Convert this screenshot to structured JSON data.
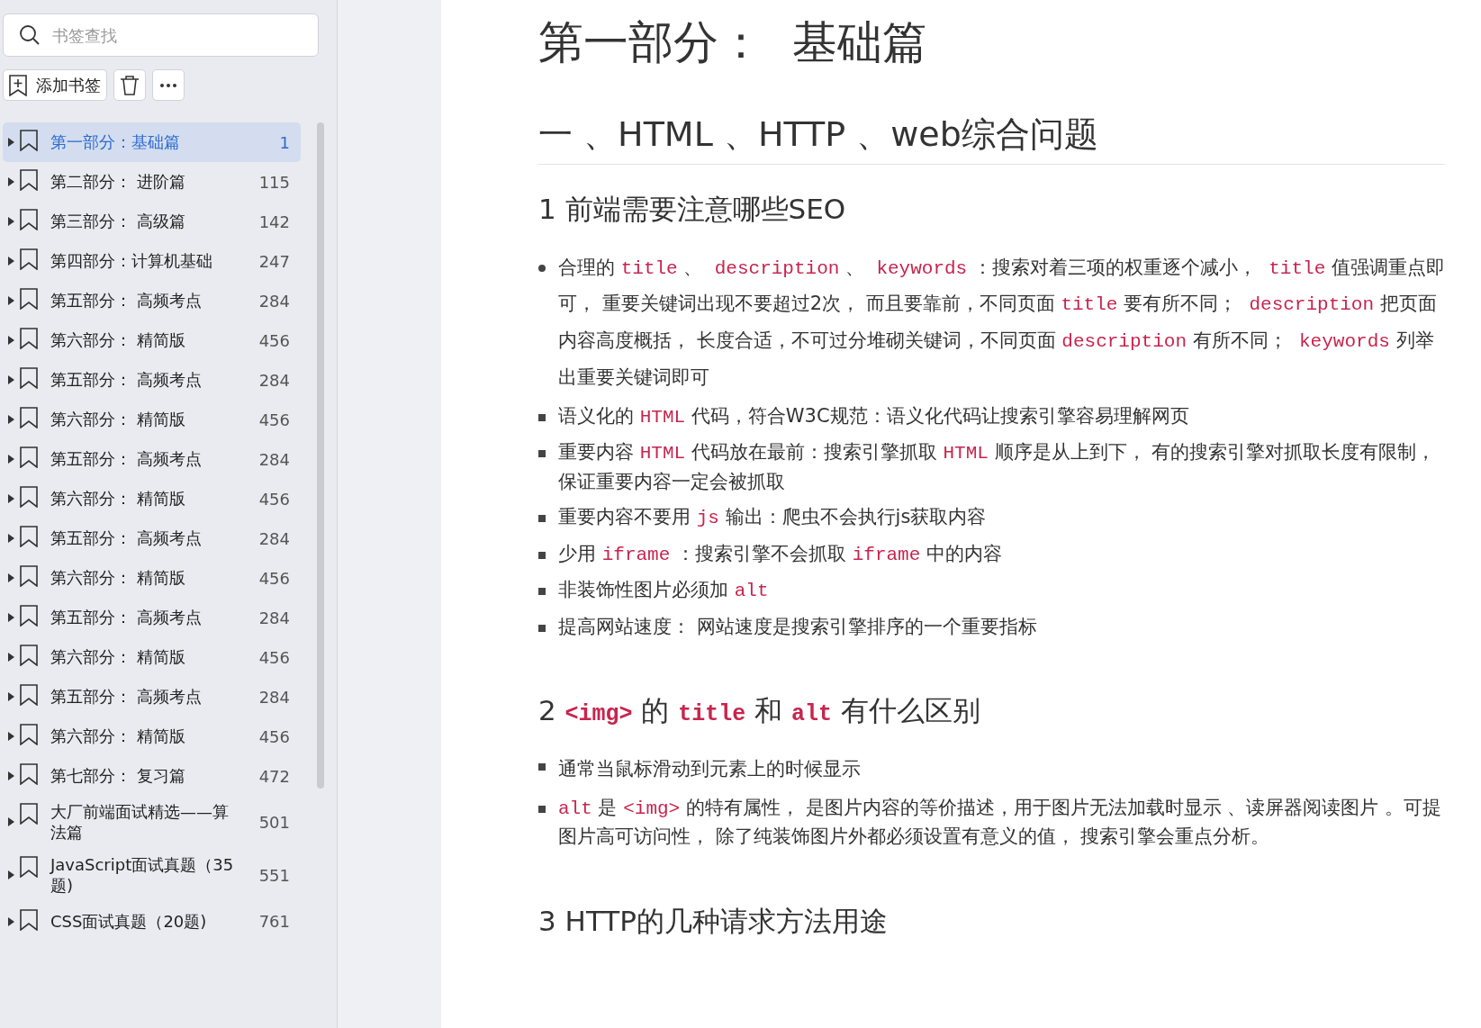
{
  "search": {
    "placeholder": "书签查找"
  },
  "toolbar": {
    "add_label": "添加书签"
  },
  "bookmarks": [
    {
      "title": "第一部分：基础篇",
      "page": "1",
      "selected": true
    },
    {
      "title": "第二部分： 进阶篇",
      "page": "115",
      "selected": false
    },
    {
      "title": "第三部分： 高级篇",
      "page": "142",
      "selected": false
    },
    {
      "title": "第四部分：计算机基础",
      "page": "247",
      "selected": false
    },
    {
      "title": "第五部分： 高频考点",
      "page": "284",
      "selected": false
    },
    {
      "title": "第六部分： 精简版",
      "page": "456",
      "selected": false
    },
    {
      "title": "第五部分： 高频考点",
      "page": "284",
      "selected": false
    },
    {
      "title": "第六部分： 精简版",
      "page": "456",
      "selected": false
    },
    {
      "title": "第五部分： 高频考点",
      "page": "284",
      "selected": false
    },
    {
      "title": "第六部分： 精简版",
      "page": "456",
      "selected": false
    },
    {
      "title": "第五部分： 高频考点",
      "page": "284",
      "selected": false
    },
    {
      "title": "第六部分： 精简版",
      "page": "456",
      "selected": false
    },
    {
      "title": "第五部分： 高频考点",
      "page": "284",
      "selected": false
    },
    {
      "title": "第六部分： 精简版",
      "page": "456",
      "selected": false
    },
    {
      "title": "第五部分： 高频考点",
      "page": "284",
      "selected": false
    },
    {
      "title": "第六部分： 精简版",
      "page": "456",
      "selected": false
    },
    {
      "title": "第七部分： 复习篇",
      "page": "472",
      "selected": false
    },
    {
      "title": "大厂前端面试精选——算法篇",
      "page": "501",
      "selected": false
    },
    {
      "title": "JavaScript面试真题（35题)",
      "page": "551",
      "selected": false
    },
    {
      "title": "CSS面试真题（20题)",
      "page": "761",
      "selected": false
    }
  ],
  "document": {
    "blocks": [
      {
        "kind": "h1",
        "segments": [
          {
            "kind": "text",
            "text": "第一部分：  基础篇"
          }
        ]
      },
      {
        "kind": "h2",
        "segments": [
          {
            "kind": "text",
            "text": "一 、HTML 、HTTP 、web综合问题"
          }
        ]
      },
      {
        "kind": "h3",
        "segments": [
          {
            "kind": "text",
            "text": "1 前端需要注意哪些SEO"
          }
        ]
      },
      {
        "kind": "list",
        "items": [
          {
            "kind": "disc",
            "segments": [
              {
                "kind": "text",
                "text": "合理的 "
              },
              {
                "kind": "code",
                "text": "title"
              },
              {
                "kind": "text",
                "text": " 、  "
              },
              {
                "kind": "code",
                "text": "description"
              },
              {
                "kind": "text",
                "text": " 、  "
              },
              {
                "kind": "code",
                "text": "keywords"
              },
              {
                "kind": "text",
                "text": " ：搜索对着三项的权重逐个减小，  "
              },
              {
                "kind": "code",
                "text": "title"
              },
              {
                "kind": "text",
                "text": " 值强调重点即可， 重要关键词出现不要超过2次， 而且要靠前，不同页面 "
              },
              {
                "kind": "code",
                "text": "title"
              },
              {
                "kind": "text",
                "text": " 要有所不同；  "
              },
              {
                "kind": "code",
                "text": "description"
              },
              {
                "kind": "text",
                "text": " 把页面内容高度概括， 长度合适，不可过分堆砌关键词，不同页面 "
              },
              {
                "kind": "code",
                "text": "description"
              },
              {
                "kind": "text",
                "text": " 有所不同；  "
              },
              {
                "kind": "code",
                "text": "keywords"
              },
              {
                "kind": "text",
                "text": " 列举出重要关键词即可"
              }
            ]
          },
          {
            "kind": "square",
            "segments": [
              {
                "kind": "text",
                "text": "语义化的 "
              },
              {
                "kind": "code",
                "text": "HTML"
              },
              {
                "kind": "text",
                "text": " 代码，符合W3C规范：语义化代码让搜索引擎容易理解网页"
              }
            ]
          },
          {
            "kind": "square",
            "segments": [
              {
                "kind": "text",
                "text": "重要内容 "
              },
              {
                "kind": "code",
                "text": "HTML"
              },
              {
                "kind": "text",
                "text": " 代码放在最前：搜索引擎抓取 "
              },
              {
                "kind": "code",
                "text": "HTML"
              },
              {
                "kind": "text",
                "text": " 顺序是从上到下， 有的搜索引擎对抓取长度有限制，保证重要内容一定会被抓取"
              }
            ]
          },
          {
            "kind": "square",
            "segments": [
              {
                "kind": "text",
                "text": "重要内容不要用 "
              },
              {
                "kind": "code",
                "text": "js"
              },
              {
                "kind": "text",
                "text": " 输出：爬虫不会执行js获取内容"
              }
            ]
          },
          {
            "kind": "square",
            "segments": [
              {
                "kind": "text",
                "text": "少用 "
              },
              {
                "kind": "code",
                "text": "iframe"
              },
              {
                "kind": "text",
                "text": " ：搜索引擎不会抓取 "
              },
              {
                "kind": "code",
                "text": "iframe"
              },
              {
                "kind": "text",
                "text": " 中的内容"
              }
            ]
          },
          {
            "kind": "square",
            "segments": [
              {
                "kind": "text",
                "text": "非装饰性图片必须加 "
              },
              {
                "kind": "code",
                "text": "alt"
              }
            ]
          },
          {
            "kind": "square",
            "segments": [
              {
                "kind": "text",
                "text": "提高网站速度： 网站速度是搜索引擎排序的一个重要指标"
              }
            ]
          }
        ]
      },
      {
        "kind": "h3",
        "segments": [
          {
            "kind": "text",
            "text": "2 "
          },
          {
            "kind": "code",
            "text": "<img>"
          },
          {
            "kind": "text",
            "text": " 的 "
          },
          {
            "kind": "code",
            "text": "title"
          },
          {
            "kind": "text",
            "text": " 和 "
          },
          {
            "kind": "code",
            "text": "alt"
          },
          {
            "kind": "text",
            "text": " 有什么区别"
          }
        ]
      },
      {
        "kind": "list",
        "items": [
          {
            "kind": "square",
            "segments": [
              {
                "kind": "text",
                "text": "通常当鼠标滑动到元素上的时候显示"
              }
            ]
          },
          {
            "kind": "square",
            "segments": [
              {
                "kind": "code",
                "text": "alt"
              },
              {
                "kind": "text",
                "text": " 是 "
              },
              {
                "kind": "code",
                "text": "<img>"
              },
              {
                "kind": "text",
                "text": " 的特有属性， 是图片内容的等价描述，用于图片无法加载时显示 、读屏器阅读图片 。可提图片高可访问性， 除了纯装饰图片外都必须设置有意义的值， 搜索引擎会重点分析。"
              }
            ]
          }
        ]
      },
      {
        "kind": "h3",
        "segments": [
          {
            "kind": "text",
            "text": "3 HTTP的几种请求方法用途"
          }
        ]
      }
    ]
  }
}
